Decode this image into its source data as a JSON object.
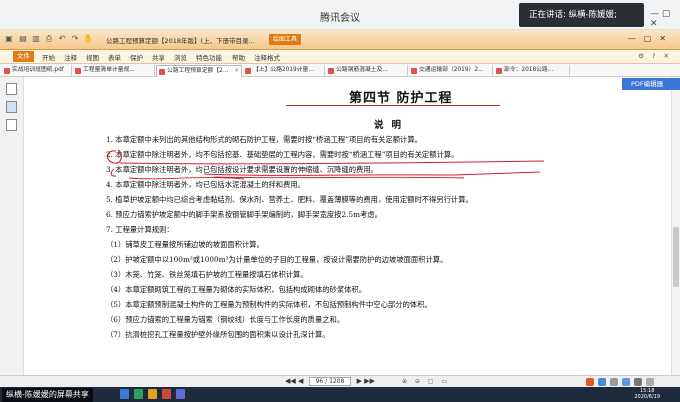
{
  "meeting": {
    "title": "腾讯会议",
    "speaker": "正在讲话: 纵横-陈媛媛;",
    "controls": "—  ▢  ✕"
  },
  "app": {
    "title": "公路工程预算定额【2018年版】(上、下册带目录... ",
    "tool_badge": "绘图工具",
    "window_controls": "—▢✕"
  },
  "menu": {
    "items": [
      "文件",
      "开始",
      "注释",
      "视图",
      "表单",
      "保护",
      "共享",
      "浏览",
      "特色功能",
      "帮助",
      "注释格式"
    ],
    "active_index": 0,
    "right": "⚙ ? ✕"
  },
  "tabs": [
    {
      "label": "实战培训班图纸.pdf"
    },
    {
      "label": "工程量清单计量规..."
    },
    {
      "label": "公路工程预算定额【2..."
    },
    {
      "label": "【上】公路2019计量..."
    },
    {
      "label": "公路钢筋混凝土及..."
    },
    {
      "label": "交通运输部（2019）2..."
    },
    {
      "label": "部令：2018公路..."
    }
  ],
  "active_tab": 2,
  "pdf_editor": "PDF编辑器",
  "document": {
    "section_title": "第四节    防护工程",
    "sub_heading": "说明",
    "lines": [
      "1. 本章定额中未列出的其他结构形式的砌石防护工程，需要时按“桥涵工程”项目的有关定额计算。",
      "2. 本章定额中除注明者外，均不包括挖基、基础垫层的工程内容，需要时按“桥涵工程”项目的有关定额计算。",
      "3. 本章定额中除注明者外，均已包括按设计要求需要设置的伸缩缝、沉降缝的费用。",
      "4. 本章定额中除注明者外，均已包括水泥混凝土的拌和费用。",
      "5. 植草护坡定额中均已综合考虑黏结剂、保水剂、营养土、肥料、覆盖薄膜等的费用，使用定额时不得另行计算。",
      "6. 预应力锚索护坡定额中的脚手架系按钢管脚手架编制的，脚手架宽度按2.5m考虑。",
      "7. 工程量计算规则：",
      "（1）铺草皮工程量按所铺边坡的坡面面积计算。",
      "（2）护坡定额中以100m²或1000m³为计量单位的子目的工程量，按设计需要防护的边坡坡面面积计算。",
      "（3）木笼、竹笼、铁丝笼填石护坡的工程量按填石体积计算。",
      "（4）本章定额砌筑工程的工程量为砌体的实际体积，包括构成砌体的砂浆体积。",
      "（5）本章定额预制混凝土构件的工程量为预制构件的实际体积，不包括预制构件中空心部分的体积。",
      "（6）预应力锚索的工程量为锚索（钢绞线）长度与工作长度的质量之和。",
      "（7）抗滑桩挖孔工程量按护壁外缘所包围的面积乘以设计孔深计算。"
    ]
  },
  "status": {
    "nav": "◀◀  ◀",
    "page": "96 / 1208",
    "nav_after": "▶  ▶▶",
    "zoom": "⊕ ⊖ ▢ ▭"
  },
  "taskbar": {
    "share_label": "纵横-陈媛媛的屏幕共享",
    "time": "15:18",
    "date": "2020/6/19"
  }
}
